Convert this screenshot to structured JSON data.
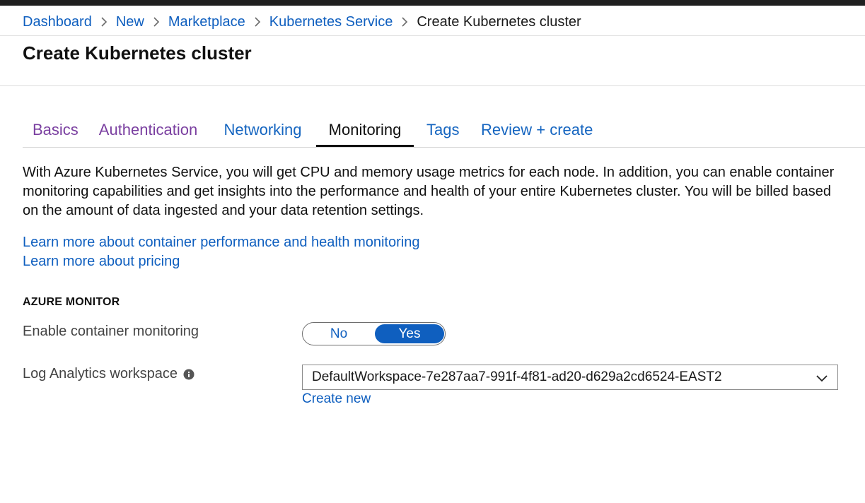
{
  "breadcrumb": {
    "items": [
      "Dashboard",
      "New",
      "Marketplace",
      "Kubernetes Service"
    ],
    "current": "Create Kubernetes cluster"
  },
  "page": {
    "title": "Create Kubernetes cluster"
  },
  "tabs": [
    {
      "label": "Basics",
      "state": "visited"
    },
    {
      "label": "Authentication",
      "state": "visited"
    },
    {
      "label": "Networking",
      "state": "link"
    },
    {
      "label": "Monitoring",
      "state": "active"
    },
    {
      "label": "Tags",
      "state": "link"
    },
    {
      "label": "Review + create",
      "state": "link"
    }
  ],
  "description": "With Azure Kubernetes Service, you will get CPU and memory usage metrics for each node. In addition, you can enable container monitoring capabilities and get insights into the performance and health of your entire Kubernetes cluster. You will be billed based on the amount of data ingested and your data retention settings.",
  "links": {
    "learn_monitoring": "Learn more about container performance and health monitoring",
    "learn_pricing": "Learn more about pricing"
  },
  "section": {
    "title": "AZURE MONITOR"
  },
  "fields": {
    "monitoring": {
      "label": "Enable container monitoring",
      "options": [
        "No",
        "Yes"
      ],
      "selected": "Yes"
    },
    "workspace": {
      "label": "Log Analytics workspace",
      "value": "DefaultWorkspace-7e287aa7-991f-4f81-ad20-d629a2cd6524-EAST2",
      "create_new": "Create new"
    }
  },
  "icons": {
    "breadcrumb_separator": "chevron-right-icon",
    "info": "info-icon",
    "dropdown": "chevron-down-icon"
  },
  "colors": {
    "link": "#0f5fbf",
    "visited_tab": "#7a3fa0",
    "toggle_active": "#0f5fbf",
    "top_bar": "#1f1f1f"
  }
}
